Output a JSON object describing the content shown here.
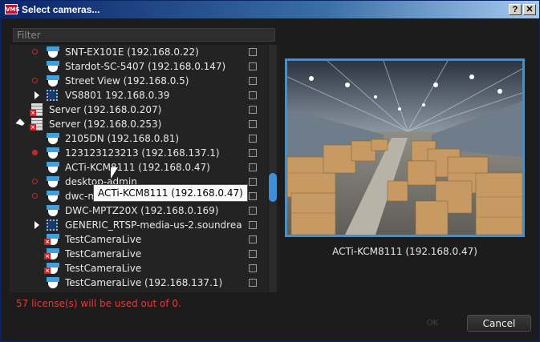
{
  "window": {
    "app_icon_text": "VMS",
    "title": "Select cameras...",
    "help_label": "?",
    "close_label": "✕"
  },
  "filter": {
    "placeholder": "Filter"
  },
  "tree": {
    "rows": [
      {
        "label": "SNT-EX101E (192.168.0.22)",
        "icon": "camera-icon",
        "recording": "outline"
      },
      {
        "label": "Stardot-SC-5407 (192.168.0.147)",
        "icon": "camera-icon",
        "recording": "none"
      },
      {
        "label": "Street View (192.168.0.5)",
        "icon": "camera-icon",
        "recording": "outline"
      },
      {
        "label": "VS8801 192.168.0.39",
        "icon": "encoder-icon",
        "expander": "collapsed"
      },
      {
        "label": "Server (192.168.0.207)",
        "icon": "server-offline-icon"
      },
      {
        "label": "Server (192.168.0.253)",
        "icon": "server-offline-icon",
        "expander": "expanded"
      },
      {
        "label": "2105DN (192.168.0.81)",
        "icon": "camera-icon",
        "recording": "none"
      },
      {
        "label": "123123123213 (192.168.137.1)",
        "icon": "camera-icon",
        "recording": "filled"
      },
      {
        "label": "ACTi-KCM8111 (192.168.0.47)",
        "icon": "camera-icon",
        "recording": "none"
      },
      {
        "label": "desktop-admin",
        "icon": "camera-icon",
        "recording": "outline"
      },
      {
        "label": "dwc-m",
        "icon": "camera-icon",
        "recording": "outline"
      },
      {
        "label": "DWC-MPTZ20X (192.168.0.169)",
        "icon": "camera-icon",
        "recording": "none"
      },
      {
        "label": "GENERIC_RTSP-media-us-2.soundreac...",
        "icon": "encoder-icon",
        "expander": "collapsed"
      },
      {
        "label": "TestCameraLive",
        "icon": "camera-offline-icon"
      },
      {
        "label": "TestCameraLive",
        "icon": "camera-offline-icon"
      },
      {
        "label": "TestCameraLive",
        "icon": "camera-offline-icon"
      },
      {
        "label": "TestCameraLive (192.168.137.1)",
        "icon": "camera-icon",
        "recording": "none"
      }
    ]
  },
  "tooltip": {
    "text": "ACTi-KCM8111 (192.168.0.47)"
  },
  "preview": {
    "label": "ACTi-KCM8111 (192.168.0.47)"
  },
  "footer": {
    "license_text": "57 license(s) will be used out of 0.",
    "ok_label": "OK",
    "cancel_label": "Cancel"
  },
  "colors": {
    "accent": "#2f95e6",
    "error": "#e03a3a",
    "recording": "#c82828"
  }
}
